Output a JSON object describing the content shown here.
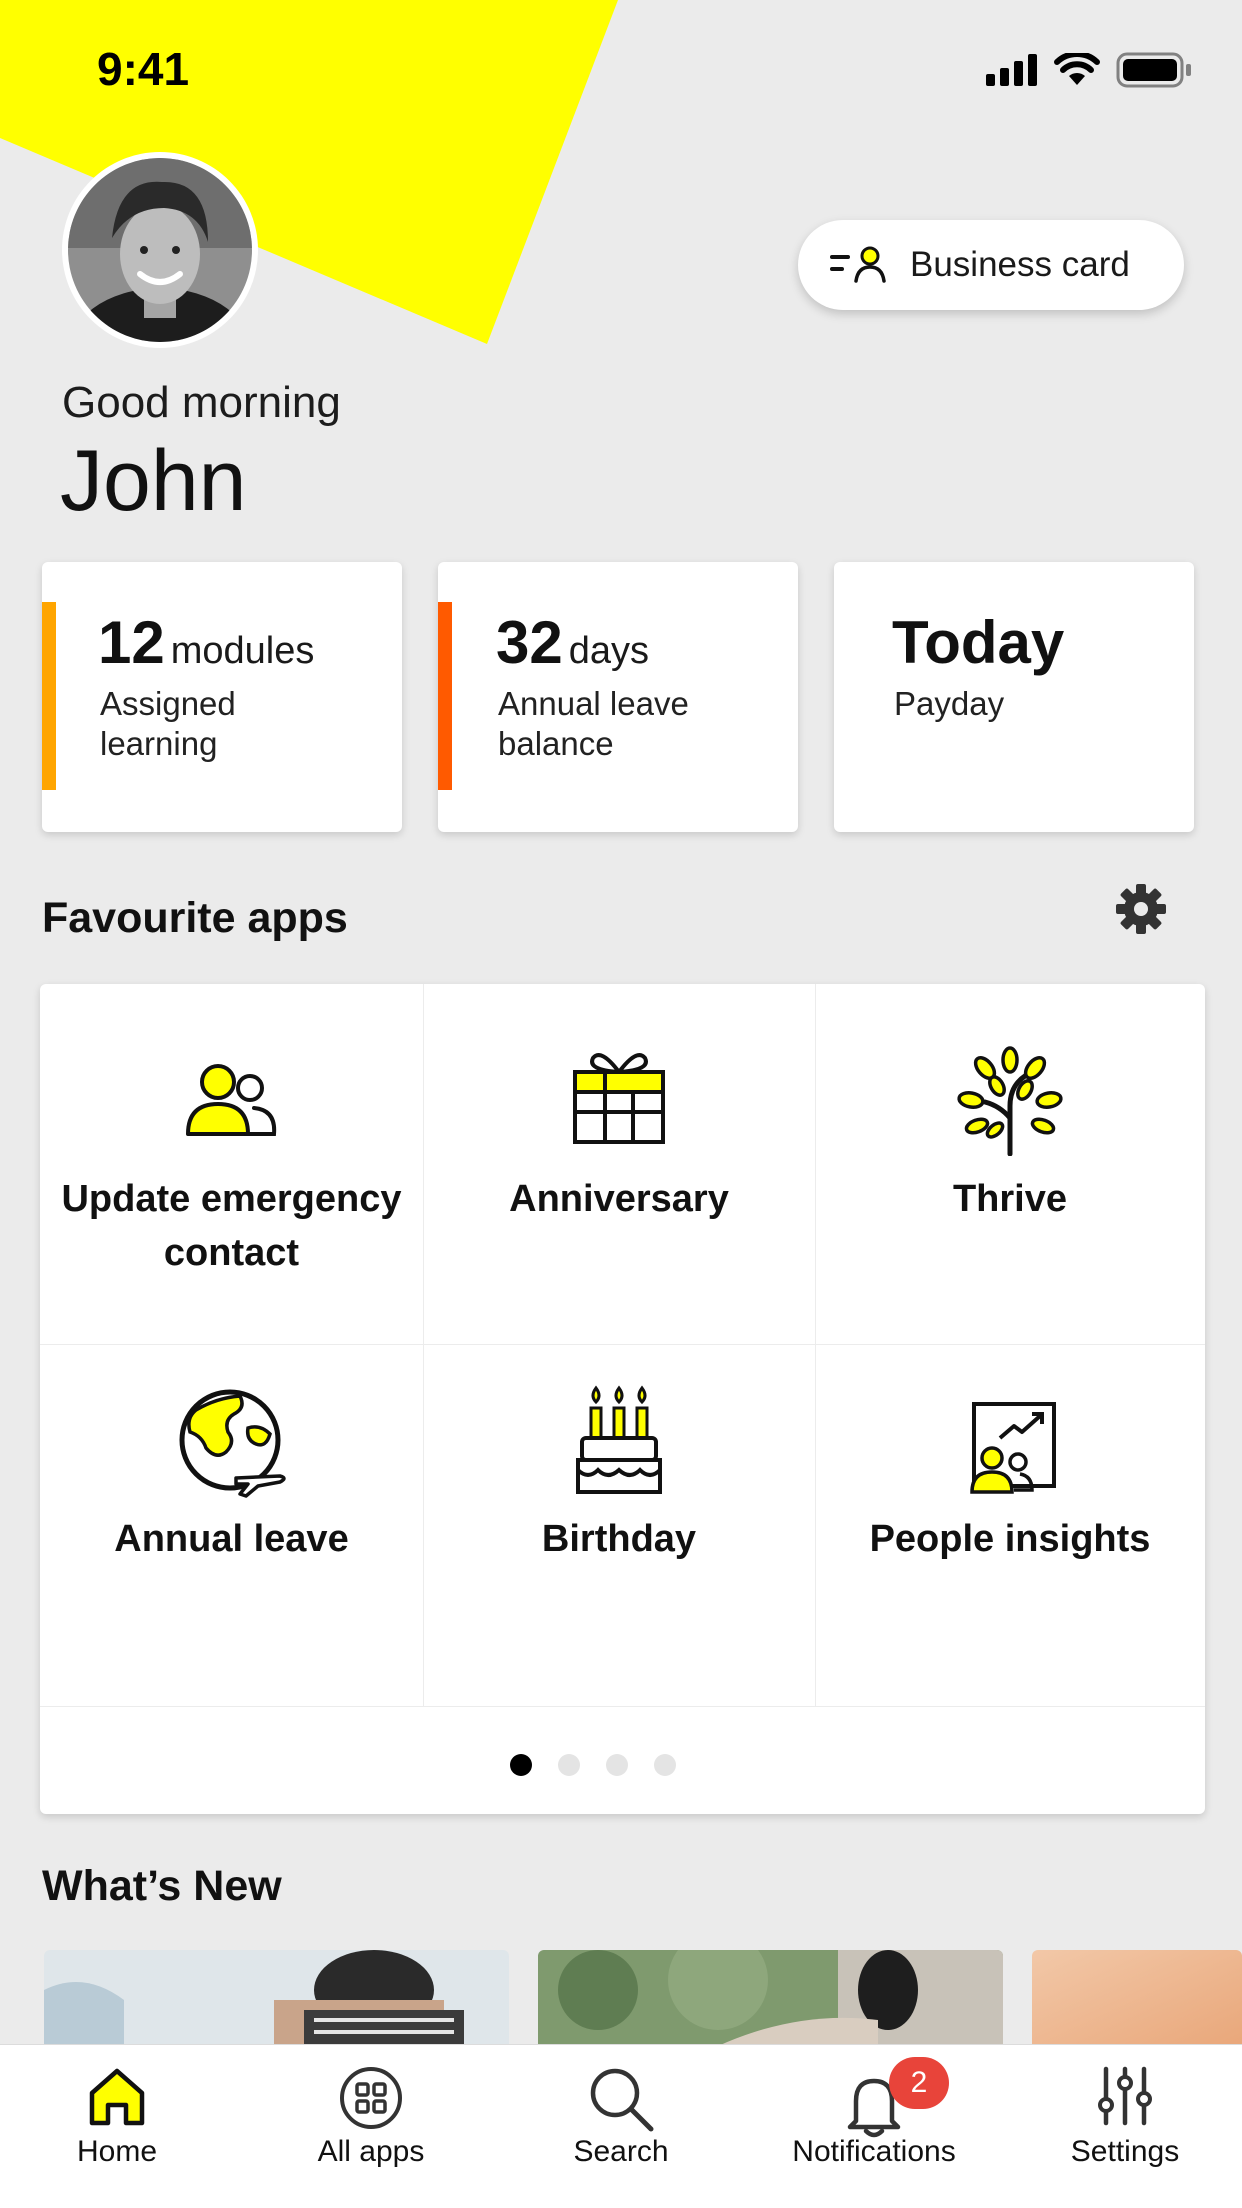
{
  "status_bar": {
    "time": "9:41"
  },
  "header": {
    "greeting": "Good morning",
    "user_name": "John",
    "business_card_label": "Business card"
  },
  "stats": [
    {
      "value": "12",
      "unit": "modules",
      "label": "Assigned learning",
      "accent": "#ffa500"
    },
    {
      "value": "32",
      "unit": "days",
      "label": "Annual leave balance",
      "accent": "#ff5a00"
    },
    {
      "value": "Today",
      "unit": "",
      "label": "Payday",
      "accent": ""
    }
  ],
  "favourite_apps": {
    "title": "Favourite apps",
    "apps": [
      {
        "label": "Update emergency contact",
        "icon": "people-icon"
      },
      {
        "label": "Anniversary",
        "icon": "gift-icon"
      },
      {
        "label": "Thrive",
        "icon": "tree-icon"
      },
      {
        "label": "Annual leave",
        "icon": "globe-plane-icon"
      },
      {
        "label": "Birthday",
        "icon": "cake-icon"
      },
      {
        "label": "People insights",
        "icon": "insights-icon"
      }
    ],
    "page_count": 4,
    "current_page": 1
  },
  "whats_new": {
    "title": "What’s New"
  },
  "tab_bar": {
    "items": [
      {
        "label": "Home",
        "icon": "home-icon"
      },
      {
        "label": "All apps",
        "icon": "all-apps-icon"
      },
      {
        "label": "Search",
        "icon": "search-icon"
      },
      {
        "label": "Notifications",
        "icon": "bell-icon",
        "badge": "2"
      },
      {
        "label": "Settings",
        "icon": "sliders-icon"
      }
    ]
  },
  "colors": {
    "brand_yellow": "#ffff00",
    "accent_orange": "#ffa500",
    "accent_red_orange": "#ff5a00",
    "badge_red": "#e8443a",
    "background": "#ebebeb"
  }
}
